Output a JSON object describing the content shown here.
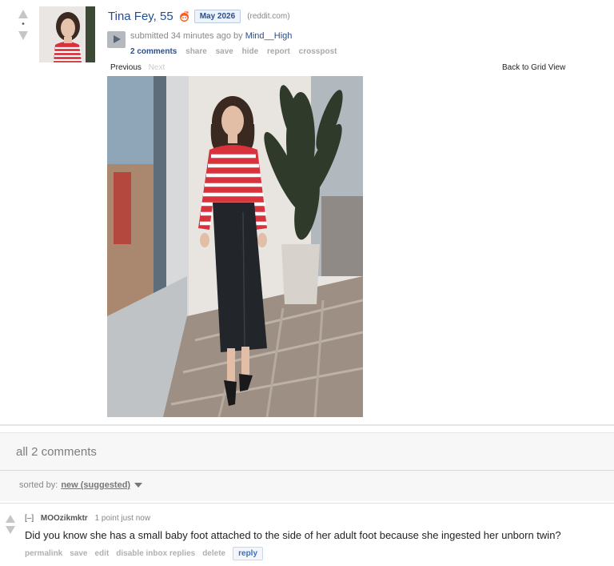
{
  "post": {
    "score": "•",
    "title": "Tina Fey, 55",
    "flair": "May 2026",
    "domain": "(reddit.com)",
    "submitted_prefix": "submitted 34 minutes ago by",
    "author": "Mind__High",
    "actions": {
      "comments": "2 comments",
      "share": "share",
      "save": "save",
      "hide": "hide",
      "report": "report",
      "crosspost": "crosspost"
    },
    "nav": {
      "previous": "Previous",
      "next": "Next",
      "grid_view": "Back to Grid View"
    }
  },
  "comments_section": {
    "title": "all 2 comments",
    "sort_label": "sorted by:",
    "sort_value": "new (suggested)"
  },
  "comment": {
    "collapse": "[–]",
    "author": "MOOzikmktr",
    "meta": "1 point just now",
    "body": "Did you know she has a small baby foot attached to the side of her adult foot because she ingested her unborn twin?",
    "actions": {
      "permalink": "permalink",
      "save": "save",
      "edit": "edit",
      "disable_inbox": "disable inbox replies",
      "delete": "delete",
      "reply": "reply"
    }
  },
  "colors": {
    "title_link": "#1c4e9c",
    "stripe_red": "#d8323d",
    "skirt": "#22262b"
  },
  "icons": {
    "vote_up": "upvote-arrow-icon",
    "vote_down": "downvote-arrow-icon",
    "flair_icon": "reddit-alien-icon",
    "expando": "play-icon",
    "sort_caret": "chevron-down-icon"
  }
}
